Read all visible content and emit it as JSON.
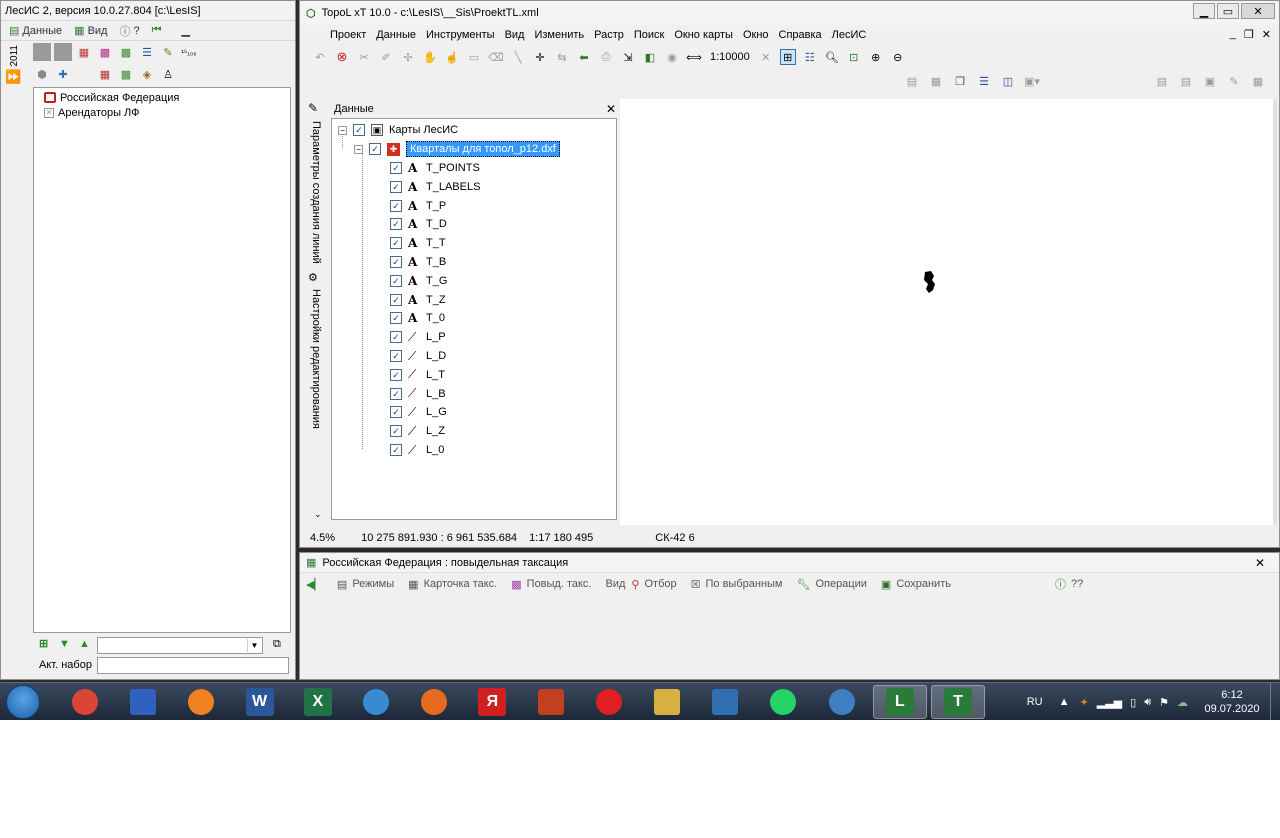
{
  "lesis": {
    "title": "ЛесИС 2, версия 10.0.27.804  [c:\\LesIS]",
    "menu": [
      "Данные",
      "Вид",
      "?"
    ],
    "year_label": "2011",
    "tree": [
      "Российская Федерация",
      "Арендаторы ЛФ"
    ],
    "akt_label": "Акт. набор",
    "combo_value": "",
    "akt_value": ""
  },
  "topol": {
    "title": "TopoL xT 10.0 - c:\\LesIS\\__Sis\\ProektTL.xml",
    "menu": [
      "Проект",
      "Данные",
      "Инструменты",
      "Вид",
      "Изменить",
      "Растр",
      "Поиск",
      "Окно карты",
      "Окно",
      "Справка",
      "ЛесИС"
    ],
    "scale": "1:10000",
    "side_tabs": [
      "Параметры создания линий",
      "Настройки редактирования"
    ],
    "panel_title": "Данные",
    "root_layer": "Карты ЛесИС",
    "group_layer": "Кварталы для топол_p12.dxf",
    "text_layers": [
      "T_POINTS",
      "T_LABELS",
      "T_P",
      "T_D",
      "T_T",
      "T_B",
      "T_G",
      "T_Z",
      "T_0"
    ],
    "line_layers": [
      "L_P",
      "L_D",
      "L_T",
      "L_B",
      "L_G",
      "L_Z",
      "L_0"
    ],
    "status": {
      "zoom": "4.5%",
      "coords": "10 275 891.930 : 6 961 535.684",
      "scale": "1:17 180 495",
      "crs": "СК-42 6"
    }
  },
  "bottom_panel": {
    "title": "Российская Федерация : повыдельная таксация",
    "tools": [
      "Режимы",
      "Карточка такс.",
      "Повыд. такс.",
      "Вид",
      "Отбор",
      "По выбранным",
      "Операции",
      "Сохранить",
      "??"
    ]
  },
  "taskbar": {
    "lang": "RU",
    "time": "6:12",
    "date": "09.07.2020",
    "apps": [
      "chrome-icon",
      "save-icon",
      "vlc-icon",
      "W",
      "X",
      "paint-icon",
      "firefox-icon",
      "Я",
      "store-icon",
      "yandex-icon",
      "folder-icon",
      "box-icon",
      "whatsapp-icon",
      "globe-icon",
      "L",
      "T"
    ]
  },
  "colors": {
    "selection": "#3399ff",
    "taskbar": "#1d2838"
  }
}
